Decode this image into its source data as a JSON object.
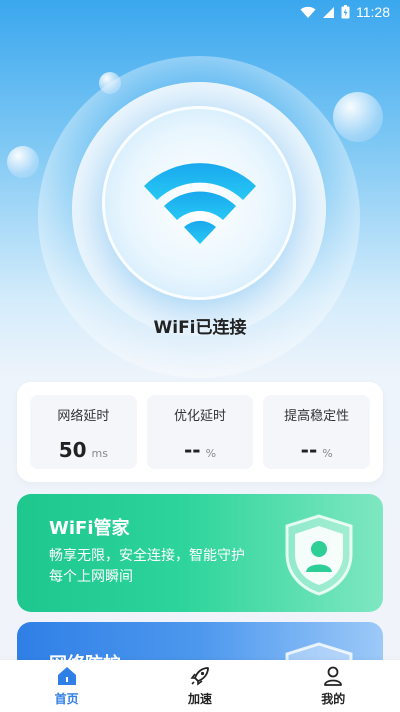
{
  "status_bar": {
    "time": "11:28",
    "icons": [
      "wifi-icon",
      "signal-icon",
      "battery-icon"
    ]
  },
  "wifi": {
    "status": "WiFi已连接"
  },
  "stats": [
    {
      "label": "网络延时",
      "value": "50",
      "unit": "ms"
    },
    {
      "label": "优化延时",
      "value": "--",
      "unit": "%"
    },
    {
      "label": "提高稳定性",
      "value": "--",
      "unit": "%"
    }
  ],
  "banners": {
    "wifi_manager": {
      "title": "WiFi管家",
      "desc": "畅享无限，安全连接，智能守护每个上网瞬间",
      "icon": "shield-user-icon"
    },
    "network_protect": {
      "title": "网络防护",
      "icon": "shield-icon"
    }
  },
  "nav": [
    {
      "label": "首页",
      "icon": "home-icon",
      "active": true
    },
    {
      "label": "加速",
      "icon": "rocket-icon",
      "active": false
    },
    {
      "label": "我的",
      "icon": "user-icon",
      "active": false
    }
  ],
  "colors": {
    "accent": "#2f7fe6",
    "green_banner": "#1dc78e",
    "blue_banner": "#2f7fe6",
    "wifi_icon": "#1ab8f0"
  }
}
